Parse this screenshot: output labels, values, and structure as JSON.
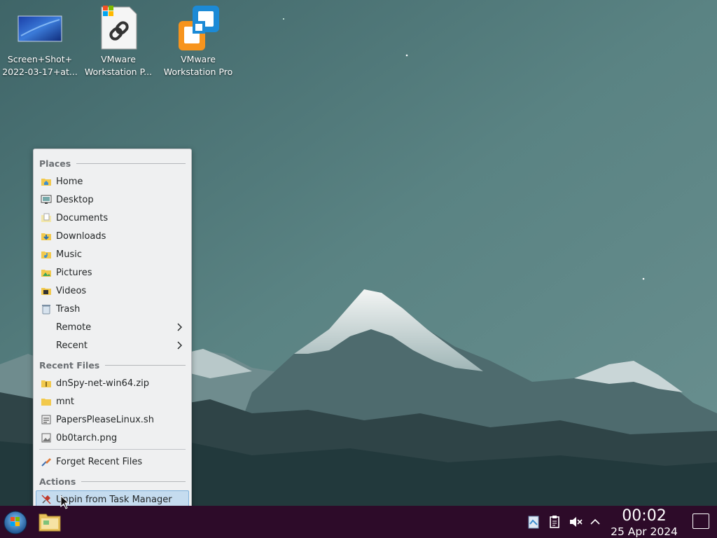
{
  "desktop": {
    "icons": [
      {
        "label_line1": "Screen+Shot+",
        "label_line2": "2022-03-17+at...",
        "icon": "image-thumbnail-icon"
      },
      {
        "label_line1": "VMware",
        "label_line2": "Workstation P...",
        "icon": "link-file-icon"
      },
      {
        "label_line1": "VMware",
        "label_line2": "Workstation Pro",
        "icon": "vmware-icon"
      }
    ]
  },
  "menu": {
    "places_header": "Places",
    "places": [
      {
        "label": "Home",
        "icon": "home-folder-icon"
      },
      {
        "label": "Desktop",
        "icon": "desktop-folder-icon"
      },
      {
        "label": "Documents",
        "icon": "documents-folder-icon"
      },
      {
        "label": "Downloads",
        "icon": "downloads-folder-icon"
      },
      {
        "label": "Music",
        "icon": "music-folder-icon"
      },
      {
        "label": "Pictures",
        "icon": "pictures-folder-icon"
      },
      {
        "label": "Videos",
        "icon": "videos-folder-icon"
      },
      {
        "label": "Trash",
        "icon": "trash-icon"
      },
      {
        "label": "Remote",
        "icon": "chevron-right-icon"
      },
      {
        "label": "Recent",
        "icon": "chevron-right-icon"
      }
    ],
    "recent_header": "Recent Files",
    "recent": [
      {
        "label": "dnSpy-net-win64.zip",
        "icon": "zip-file-icon"
      },
      {
        "label": "mnt",
        "icon": "folder-icon"
      },
      {
        "label": "PapersPleaseLinux.sh",
        "icon": "script-file-icon"
      },
      {
        "label": "0b0tarch.png",
        "icon": "image-file-icon"
      }
    ],
    "forget_label": "Forget Recent Files",
    "actions_header": "Actions",
    "unpin_label": "Unpin from Task Manager"
  },
  "taskbar": {
    "time": "00:02",
    "date": "25 Apr 2024"
  },
  "colors": {
    "taskbar_bg": "#2d0b29",
    "menu_bg": "#eff0f1",
    "highlight": "#c5dcef"
  }
}
